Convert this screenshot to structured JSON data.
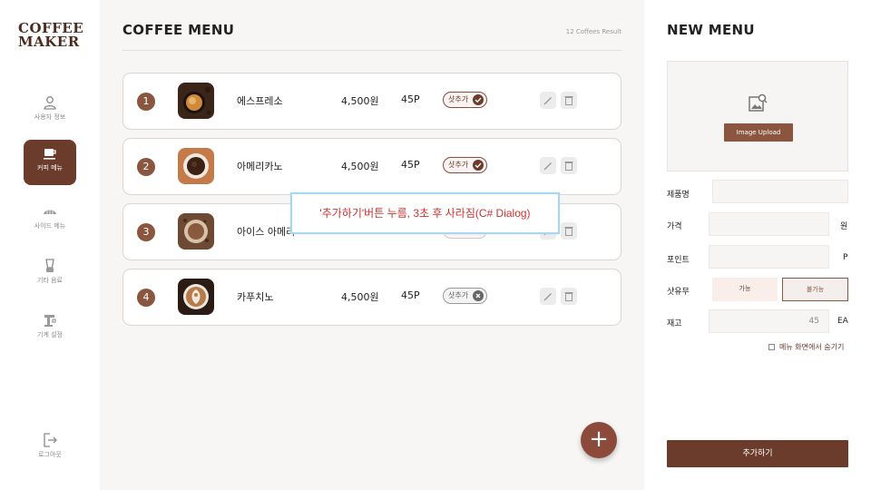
{
  "logo": {
    "line1": "COFFEE",
    "line2": "MAKER"
  },
  "sidebar": {
    "items": [
      {
        "label": "사용자 정보",
        "icon": "user-icon"
      },
      {
        "label": "커피 메뉴",
        "icon": "coffee-cup-icon",
        "active": true
      },
      {
        "label": "사이드 메뉴",
        "icon": "croissant-icon"
      },
      {
        "label": "기타 음료",
        "icon": "blender-icon"
      },
      {
        "label": "기계 설정",
        "icon": "machine-icon"
      }
    ],
    "logout": {
      "label": "로그아웃",
      "icon": "logout-icon"
    }
  },
  "main": {
    "title": "COFFEE MENU",
    "result_text": "12 Coffees Result",
    "items": [
      {
        "num": "1",
        "name": "에스프레소",
        "price": "4,500원",
        "point": "45P",
        "shot_label": "샷추가",
        "shot_enabled": true
      },
      {
        "num": "2",
        "name": "아메리카노",
        "price": "4,500원",
        "point": "45P",
        "shot_label": "샷추가",
        "shot_enabled": true
      },
      {
        "num": "3",
        "name": "아이스 아메리",
        "price": "",
        "point": "",
        "shot_label": "",
        "shot_enabled": true
      },
      {
        "num": "4",
        "name": "카푸치노",
        "price": "4,500원",
        "point": "45P",
        "shot_label": "샷추가",
        "shot_enabled": false
      }
    ]
  },
  "dialog": {
    "text": "'추가하기'버튼 누름, 3초  후 사라짐(C# Dialog)"
  },
  "fab": {
    "label": "+"
  },
  "panel": {
    "title": "NEW MENU",
    "upload_label": "Image Upload",
    "fields": {
      "name_label": "제품명",
      "price_label": "가격",
      "price_unit": "원",
      "point_label": "포인트",
      "point_unit": "P",
      "shot_label": "샷유무",
      "shot_yes": "가능",
      "shot_no": "불가능",
      "stock_label": "재고",
      "stock_value": "45",
      "stock_unit": "EA"
    },
    "hide_label": "메뉴 화면에서 숨기기",
    "submit_label": "추가하기"
  },
  "colors": {
    "brand": "#6b3c2c",
    "accent": "#8b563f",
    "dialog_text": "#d0312d",
    "dialog_border": "#a9d7f0"
  }
}
